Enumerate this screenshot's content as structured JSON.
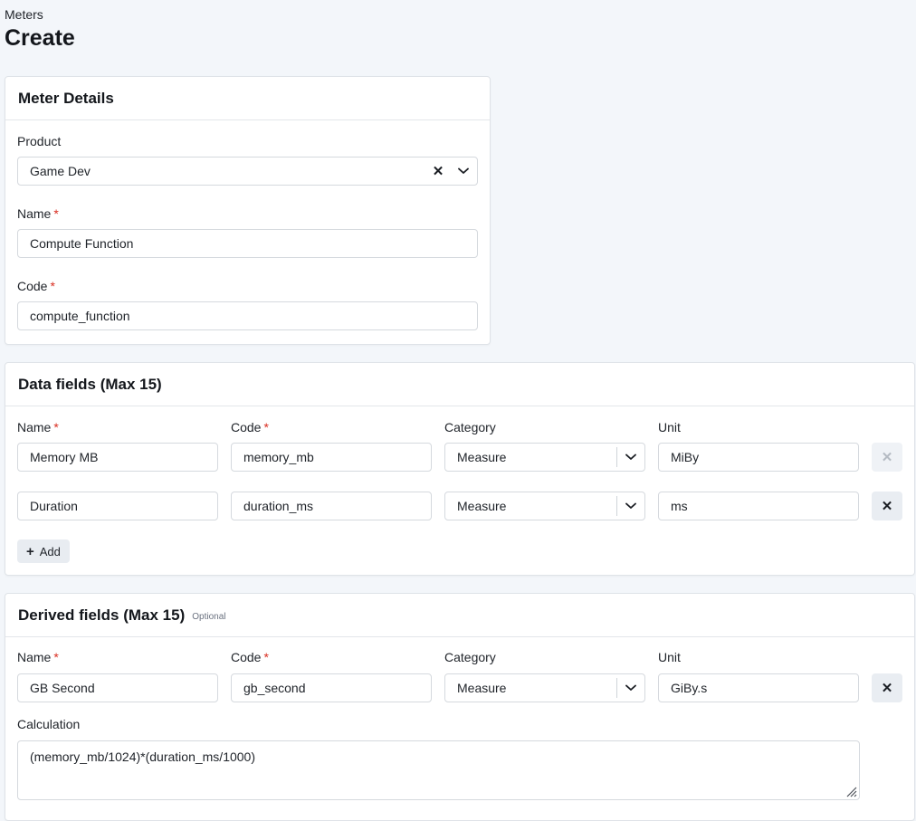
{
  "breadcrumb": "Meters",
  "title": "Create",
  "meter_details": {
    "header": "Meter Details",
    "product_label": "Product",
    "product_value": "Game Dev",
    "name_label": "Name",
    "name_value": "Compute Function",
    "code_label": "Code",
    "code_value": "compute_function",
    "required_mark": "*"
  },
  "data_fields": {
    "header": "Data fields (Max 15)",
    "columns": {
      "name": "Name",
      "code": "Code",
      "category": "Category",
      "unit": "Unit"
    },
    "rows": [
      {
        "name": "Memory MB",
        "code": "memory_mb",
        "category": "Measure",
        "unit": "MiBy",
        "remove_disabled": true
      },
      {
        "name": "Duration",
        "code": "duration_ms",
        "category": "Measure",
        "unit": "ms",
        "remove_disabled": false
      }
    ],
    "add_label": "Add"
  },
  "derived_fields": {
    "header": "Derived fields (Max 15)",
    "optional_label": "Optional",
    "columns": {
      "name": "Name",
      "code": "Code",
      "category": "Category",
      "unit": "Unit"
    },
    "rows": [
      {
        "name": "GB Second",
        "code": "gb_second",
        "category": "Measure",
        "unit": "GiBy.s"
      }
    ],
    "calculation_label": "Calculation",
    "calculation_value": "(memory_mb/1024)*(duration_ms/1000)"
  }
}
